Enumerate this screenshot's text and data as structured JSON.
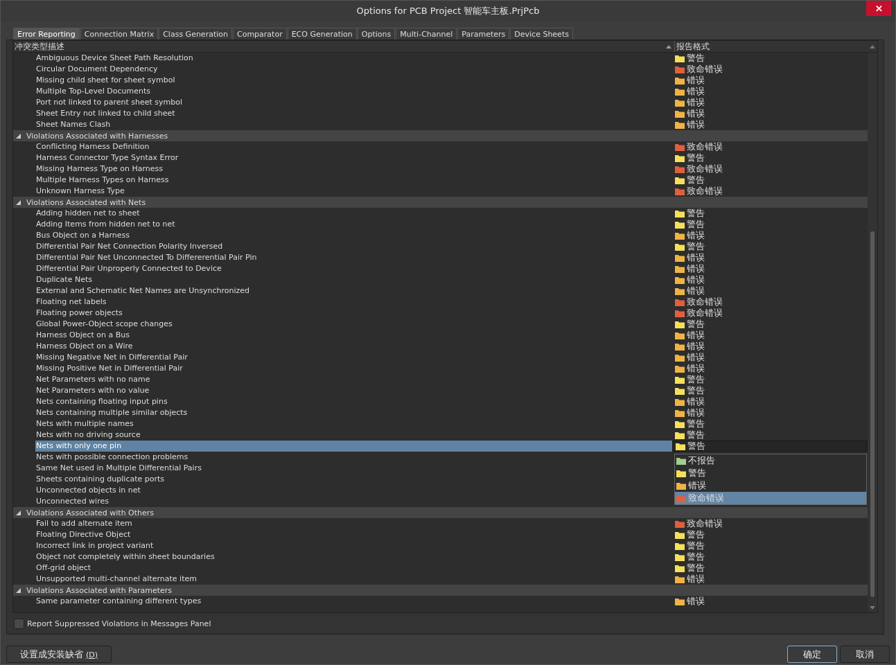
{
  "window": {
    "title": "Options for PCB Project 智能车主板.PrjPcb",
    "close": "✕"
  },
  "tabs": [
    {
      "label": "Error Reporting",
      "selected": true
    },
    {
      "label": "Connection Matrix",
      "selected": false
    },
    {
      "label": "Class Generation",
      "selected": false
    },
    {
      "label": "Comparator",
      "selected": false
    },
    {
      "label": "ECO Generation",
      "selected": false
    },
    {
      "label": "Options",
      "selected": false
    },
    {
      "label": "Multi-Channel",
      "selected": false
    },
    {
      "label": "Parameters",
      "selected": false
    },
    {
      "label": "Device Sheets",
      "selected": false
    }
  ],
  "table": {
    "columns": [
      "冲突类型描述",
      "报告格式"
    ],
    "groups": [
      {
        "rows": [
          {
            "name": "Ambiguous Device Sheet Path Resolution",
            "selected": false,
            "report": {
              "text": "警告",
              "color": "#f6e05a"
            }
          },
          {
            "name": "Circular Document Dependency",
            "selected": false,
            "report": {
              "text": "致命错误",
              "color": "#e0603e"
            }
          },
          {
            "name": "Missing child sheet for sheet symbol",
            "selected": false,
            "report": {
              "text": "错误",
              "color": "#f0b444"
            }
          },
          {
            "name": "Multiple Top-Level Documents",
            "selected": false,
            "report": {
              "text": "错误",
              "color": "#f0b444"
            }
          },
          {
            "name": "Port not linked to parent sheet symbol",
            "selected": false,
            "report": {
              "text": "错误",
              "color": "#f0b444"
            }
          },
          {
            "name": "Sheet Entry not linked to child sheet",
            "selected": false,
            "report": {
              "text": "错误",
              "color": "#f0b444"
            }
          },
          {
            "name": "Sheet Names Clash",
            "selected": false,
            "report": {
              "text": "错误",
              "color": "#f0b444"
            }
          }
        ]
      },
      {
        "title": "Violations Associated with Harnesses",
        "expanded": true,
        "rows": [
          {
            "name": "Conflicting Harness Definition",
            "selected": false,
            "report": {
              "text": "致命错误",
              "color": "#e0603e"
            }
          },
          {
            "name": "Harness Connector Type Syntax Error",
            "selected": false,
            "report": {
              "text": "警告",
              "color": "#f6e05a"
            }
          },
          {
            "name": "Missing Harness Type on Harness",
            "selected": false,
            "report": {
              "text": "致命错误",
              "color": "#e0603e"
            }
          },
          {
            "name": "Multiple Harness Types on Harness",
            "selected": false,
            "report": {
              "text": "警告",
              "color": "#f6e05a"
            }
          },
          {
            "name": "Unknown Harness Type",
            "selected": false,
            "report": {
              "text": "致命错误",
              "color": "#e0603e"
            }
          }
        ]
      },
      {
        "title": "Violations Associated with Nets",
        "expanded": true,
        "rows": [
          {
            "name": "Adding hidden net to sheet",
            "selected": false,
            "report": {
              "text": "警告",
              "color": "#f6e05a"
            }
          },
          {
            "name": "Adding Items from hidden net to net",
            "selected": false,
            "report": {
              "text": "警告",
              "color": "#f6e05a"
            }
          },
          {
            "name": "Bus Object on a Harness",
            "selected": false,
            "report": {
              "text": "错误",
              "color": "#f0b444"
            }
          },
          {
            "name": "Differential Pair Net Connection Polarity Inversed",
            "selected": false,
            "report": {
              "text": "警告",
              "color": "#f6e05a"
            }
          },
          {
            "name": "Differential Pair Net Unconnected To Differerential Pair Pin",
            "selected": false,
            "report": {
              "text": "错误",
              "color": "#f0b444"
            }
          },
          {
            "name": "Differential Pair Unproperly Connected to Device",
            "selected": false,
            "report": {
              "text": "错误",
              "color": "#f0b444"
            }
          },
          {
            "name": "Duplicate Nets",
            "selected": false,
            "report": {
              "text": "错误",
              "color": "#f0b444"
            }
          },
          {
            "name": "External and Schematic Net Names are Unsynchronized",
            "selected": false,
            "report": {
              "text": "错误",
              "color": "#f0b444"
            }
          },
          {
            "name": "Floating net labels",
            "selected": false,
            "report": {
              "text": "致命错误",
              "color": "#e0603e"
            }
          },
          {
            "name": "Floating power objects",
            "selected": false,
            "report": {
              "text": "致命错误",
              "color": "#e0603e"
            }
          },
          {
            "name": "Global Power-Object scope changes",
            "selected": false,
            "report": {
              "text": "警告",
              "color": "#f6e05a"
            }
          },
          {
            "name": "Harness Object on a Bus",
            "selected": false,
            "report": {
              "text": "错误",
              "color": "#f0b444"
            }
          },
          {
            "name": "Harness Object on a Wire",
            "selected": false,
            "report": {
              "text": "错误",
              "color": "#f0b444"
            }
          },
          {
            "name": "Missing Negative Net in Differential Pair",
            "selected": false,
            "report": {
              "text": "错误",
              "color": "#f0b444"
            }
          },
          {
            "name": "Missing Positive Net in Differential Pair",
            "selected": false,
            "report": {
              "text": "错误",
              "color": "#f0b444"
            }
          },
          {
            "name": "Net Parameters with no name",
            "selected": false,
            "report": {
              "text": "警告",
              "color": "#f6e05a"
            }
          },
          {
            "name": "Net Parameters with no value",
            "selected": false,
            "report": {
              "text": "警告",
              "color": "#f6e05a"
            }
          },
          {
            "name": "Nets containing floating input pins",
            "selected": false,
            "report": {
              "text": "错误",
              "color": "#f0b444"
            }
          },
          {
            "name": "Nets containing multiple similar objects",
            "selected": false,
            "report": {
              "text": "错误",
              "color": "#f0b444"
            }
          },
          {
            "name": "Nets with multiple names",
            "selected": false,
            "report": {
              "text": "警告",
              "color": "#f6e05a"
            }
          },
          {
            "name": "Nets with no driving source",
            "selected": false,
            "report": {
              "text": "警告",
              "color": "#f6e05a"
            }
          },
          {
            "name": "Nets with only one pin",
            "selected": true,
            "report": {
              "text": "警告",
              "color": "#f6e05a"
            },
            "dropdown": [
              {
                "text": "不报告",
                "color": "#9fcf8e",
                "selected": false
              },
              {
                "text": "警告",
                "color": "#f6e05a",
                "selected": false
              },
              {
                "text": "错误",
                "color": "#f0b444",
                "selected": false
              },
              {
                "text": "致命错误",
                "color": "#e0603e",
                "selected": true
              }
            ]
          },
          {
            "name": "Nets with possible connection problems",
            "selected": false
          },
          {
            "name": "Same Net used in Multiple Differential Pairs",
            "selected": false
          },
          {
            "name": "Sheets containing duplicate ports",
            "selected": false
          },
          {
            "name": "Unconnected objects in net",
            "selected": false
          },
          {
            "name": "Unconnected wires",
            "selected": false
          }
        ]
      },
      {
        "title": "Violations Associated with Others",
        "expanded": true,
        "rows": [
          {
            "name": "Fail to add alternate item",
            "selected": false,
            "report": {
              "text": "致命错误",
              "color": "#e0603e"
            }
          },
          {
            "name": "Floating Directive Object",
            "selected": false,
            "report": {
              "text": "警告",
              "color": "#f6e05a"
            }
          },
          {
            "name": "Incorrect link in project variant",
            "selected": false,
            "report": {
              "text": "警告",
              "color": "#f6e05a"
            }
          },
          {
            "name": "Object not completely within sheet boundaries",
            "selected": false,
            "report": {
              "text": "警告",
              "color": "#f6e05a"
            }
          },
          {
            "name": "Off-grid object",
            "selected": false,
            "report": {
              "text": "警告",
              "color": "#f6e05a"
            }
          },
          {
            "name": "Unsupported multi-channel alternate item",
            "selected": false,
            "report": {
              "text": "错误",
              "color": "#f0b444"
            }
          }
        ]
      },
      {
        "title": "Violations Associated with Parameters",
        "expanded": true,
        "rows": [
          {
            "name": "Same parameter containing different types",
            "selected": false,
            "report": {
              "text": "错误",
              "color": "#f0b444"
            }
          }
        ]
      }
    ]
  },
  "report_suppressed": {
    "label": "Report Suppressed Violations in Messages Panel",
    "checked": false
  },
  "buttons": {
    "defaults": "设置成安装缺省",
    "defaults_key": "(D)",
    "ok": "确定",
    "cancel": "取消"
  }
}
